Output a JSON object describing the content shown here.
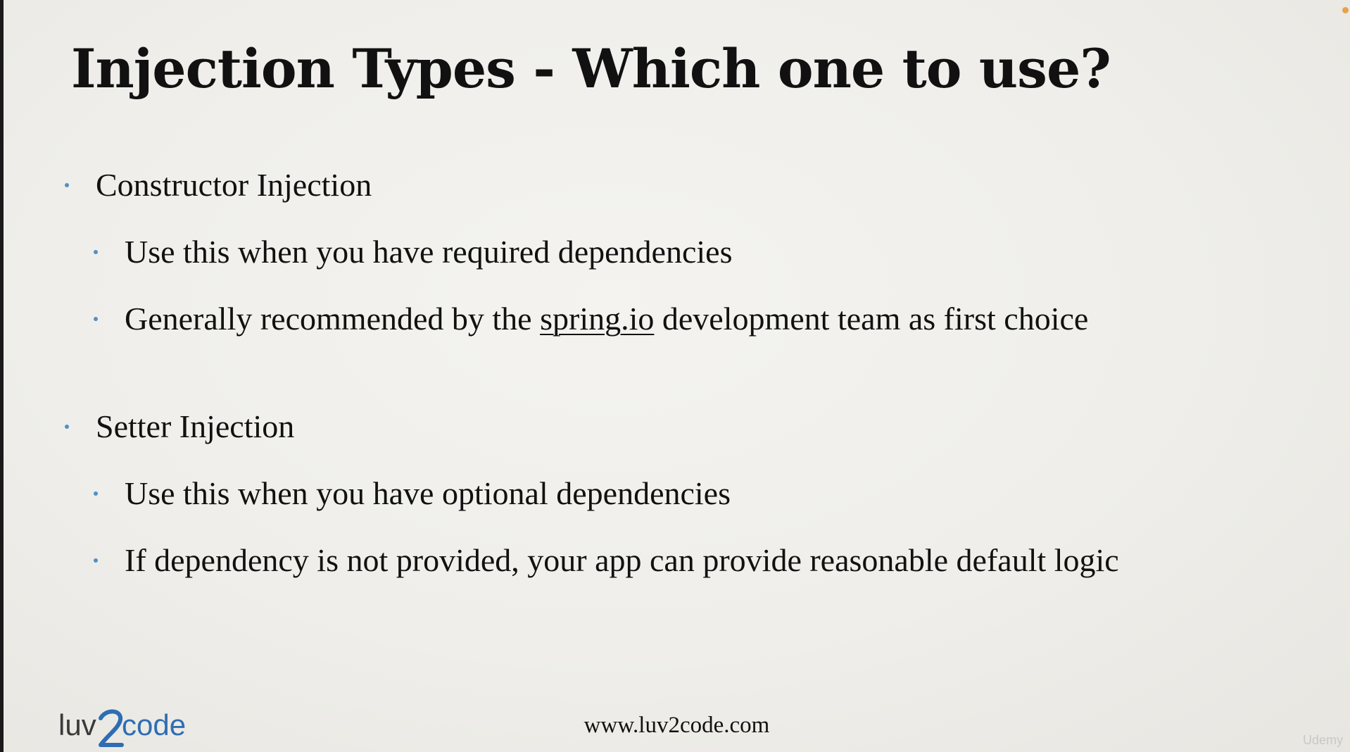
{
  "slide": {
    "title": "Injection Types - Which one to use?",
    "sections": [
      {
        "heading": "Constructor Injection",
        "points": [
          {
            "text": "Use this when you have required dependencies"
          },
          {
            "before": "Generally recommended by the ",
            "link": "spring.io",
            "after": " development team as first choice"
          }
        ]
      },
      {
        "heading": "Setter Injection",
        "points": [
          {
            "text": "Use this when you have optional dependencies"
          },
          {
            "text": "If dependency is not provided, your app can provide reasonable default logic"
          }
        ]
      }
    ],
    "footer_url": "www.luv2code.com",
    "logo_text": "luv2code",
    "watermark": "Udemy"
  },
  "colors": {
    "bullet": "#4f90c8",
    "logo_blue": "#2f6db3",
    "logo_gray": "#3a3a3a",
    "text": "#111111"
  }
}
